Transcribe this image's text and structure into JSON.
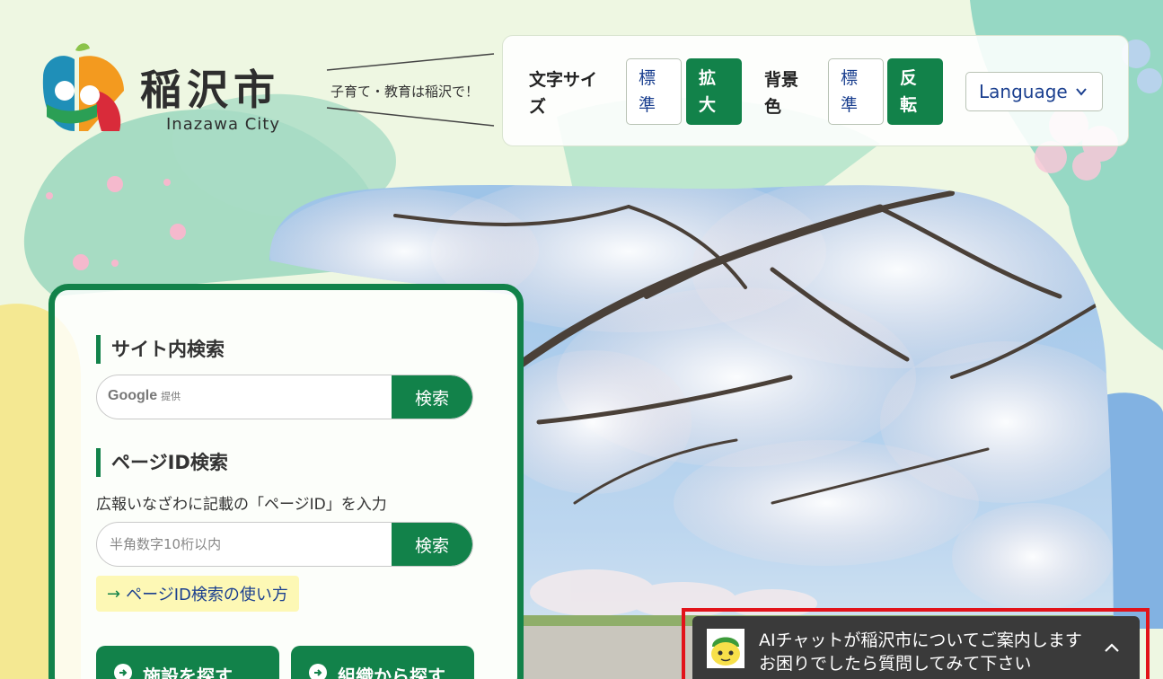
{
  "header": {
    "logo_name": "稲沢市",
    "logo_en": "Inazawa City",
    "tagline": "子育て・教育は稲沢で！"
  },
  "settings": {
    "font_size_label": "文字サイズ",
    "font_size_standard": "標準",
    "font_size_large": "拡大",
    "bg_color_label": "背景色",
    "bg_standard": "標準",
    "bg_invert": "反転",
    "language": "Language"
  },
  "search": {
    "site_search_title": "サイト内検索",
    "google_label": "Google",
    "google_sub": "提供",
    "site_search_button": "検索",
    "page_id_title": "ページID検索",
    "page_id_desc": "広報いなざわに記載の「ページID」を入力",
    "page_id_placeholder": "半角数字10桁以内",
    "page_id_button": "検索",
    "howto_link": "ページID検索の使い方"
  },
  "nav": {
    "facilities": "施設を探す",
    "organization": "組織から探す"
  },
  "chat": {
    "line1": "AIチャットが稲沢市についてご案内します",
    "line2": "お困りでしたら質問してみて下さい"
  },
  "colors": {
    "brand_green": "#12824a",
    "link_blue": "#1a3f8f",
    "highlight_red": "#e2131a"
  }
}
